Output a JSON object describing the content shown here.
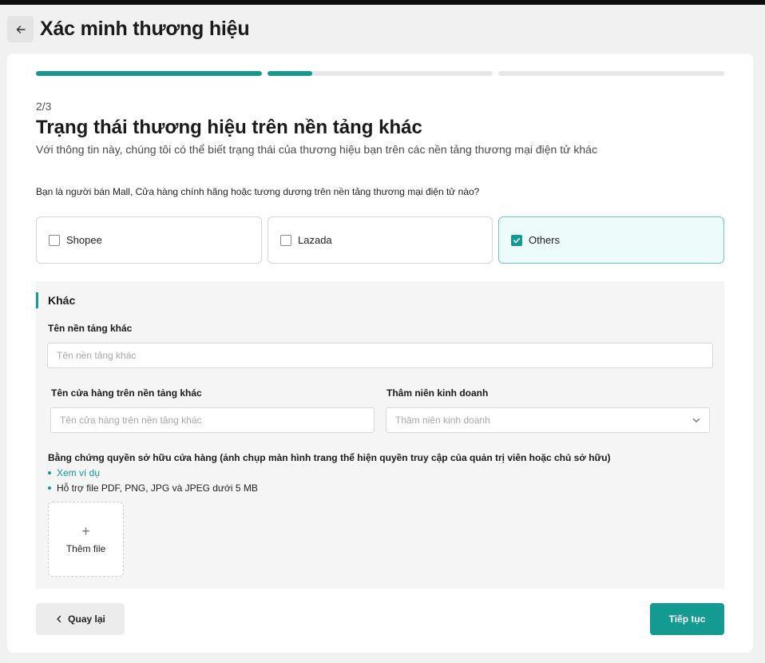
{
  "header": {
    "title": "Xác minh thương hiệu"
  },
  "progress": {
    "segments": [
      1.0,
      0.2,
      0.0
    ],
    "accent": "#139a93",
    "track": "#e6e6e6"
  },
  "step": {
    "indicator": "2/3",
    "title": "Trạng thái thương hiệu trên nền tảng khác",
    "description": "Với thông tin này, chúng tôi có thể biết trạng thái của thương hiệu bạn trên các nền tảng thương mại điện tử khác"
  },
  "question": "Bạn là người bán Mall, Cửa hàng chính hãng hoặc tương dương trên nền tảng thương mại điện tử nào?",
  "options": [
    {
      "label": "Shopee",
      "checked": false
    },
    {
      "label": "Lazada",
      "checked": false
    },
    {
      "label": "Others",
      "checked": true
    }
  ],
  "other_section": {
    "title": "Khác",
    "platform_name": {
      "label": "Tên nền tảng khác",
      "placeholder": "Tên nền tảng khác",
      "value": ""
    },
    "store_name": {
      "label": "Tên cửa hàng trên nền tảng khác",
      "placeholder": "Tên cửa hàng trên nền tảng khác",
      "value": ""
    },
    "seniority": {
      "label": "Thâm niên kinh doanh",
      "placeholder": "Thâm niên kinh doanh"
    },
    "proof": {
      "label": "Bằng chứng quyền sở hữu cửa hàng (ảnh chụp màn hình trang thể hiện quyền truy cập của quản trị viên hoặc chủ sở hữu)",
      "example_link": "Xem ví dụ",
      "support_note": "Hỗ trợ file PDF, PNG, JPG và JPEG dưới 5 MB",
      "add_file": "Thêm file"
    }
  },
  "footer": {
    "back_label": "Quay lại",
    "next_label": "Tiếp tục"
  },
  "icons": {
    "back": "arrow-left-icon",
    "check": "checkmark-icon",
    "dropdown": "chevron-down-icon",
    "add": "plus-icon",
    "prev": "chevron-left-icon"
  }
}
